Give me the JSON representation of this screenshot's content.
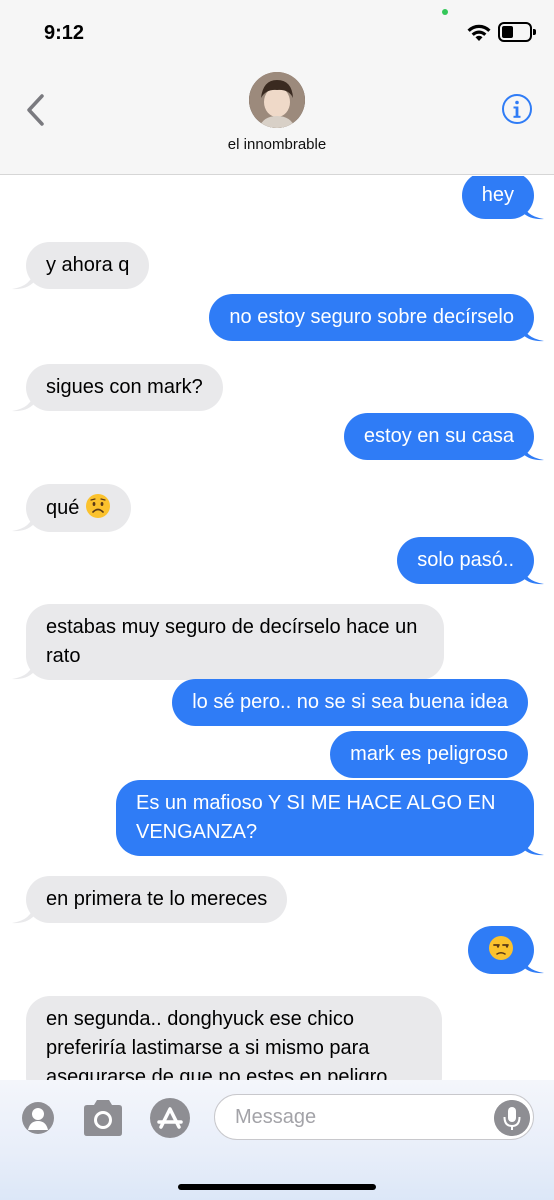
{
  "status_bar": {
    "time": "9:12"
  },
  "header": {
    "contact_name": "el innombrable",
    "back_icon": "chevron-left-icon",
    "info_icon": "info-circle-icon",
    "accent_color": "#2f7cf6"
  },
  "messages": [
    {
      "side": "out",
      "text": "hey"
    },
    {
      "side": "in",
      "text": "y ahora q"
    },
    {
      "side": "out",
      "text": "no estoy seguro sobre decírselo"
    },
    {
      "side": "in",
      "text": "sigues con mark?"
    },
    {
      "side": "out",
      "text": "estoy en su casa"
    },
    {
      "side": "in",
      "text": "qué",
      "emoji": "worried-face-emoji"
    },
    {
      "side": "out",
      "text": "solo pasó.."
    },
    {
      "side": "in",
      "text": "estabas muy seguro de decírselo hace un rato"
    },
    {
      "side": "out",
      "text": "lo sé pero.. no se si sea buena idea"
    },
    {
      "side": "out",
      "text": "mark es peligroso"
    },
    {
      "side": "out",
      "text": "Es un mafioso Y SI ME HACE ALGO EN VENGANZA?"
    },
    {
      "side": "in",
      "text": "en primera te lo mereces"
    },
    {
      "side": "out",
      "text": "",
      "emoji": "unamused-face-emoji"
    },
    {
      "side": "in",
      "text": "en segunda.. donghyuck ese chico preferiría lastimarse a si mismo para asegurarse de que no estes en peligro"
    }
  ],
  "input_bar": {
    "placeholder": "Message",
    "icons": [
      "memoji-icon",
      "camera-icon",
      "app-store-icon",
      "microphone-icon"
    ]
  },
  "colors": {
    "outgoing_bubble": "#2f7cf6",
    "incoming_bubble": "#e9e9eb"
  }
}
